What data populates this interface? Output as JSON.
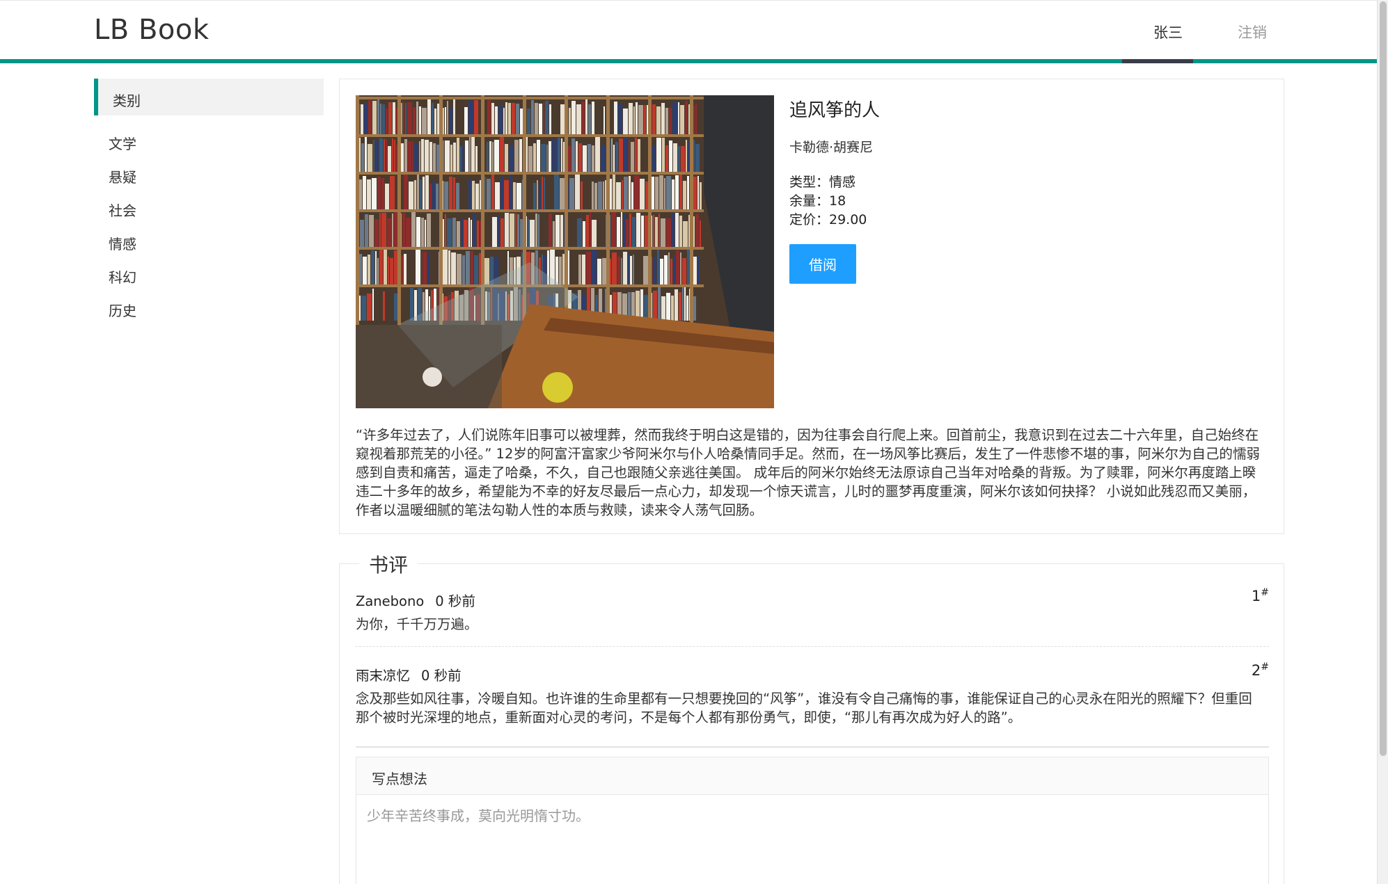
{
  "header": {
    "brand": "LB Book",
    "user": "张三",
    "logout": "注销"
  },
  "sidebar": {
    "heading": "类别",
    "categories": [
      "文学",
      "悬疑",
      "社会",
      "情感",
      "科幻",
      "历史"
    ]
  },
  "book": {
    "title": "追风筝的人",
    "author": "卡勒德·胡赛尼",
    "type_label": "类型：情感",
    "stock_label": "余量：18",
    "price_label": "定价：29.00",
    "borrow_label": "借阅",
    "description": "“许多年过去了，人们说陈年旧事可以被埋葬，然而我终于明白这是错的，因为往事会自行爬上来。回首前尘，我意识到在过去二十六年里，自己始终在窥视着那荒芜的小径。” 12岁的阿富汗富家少爷阿米尔与仆人哈桑情同手足。然而，在一场风筝比赛后，发生了一件悲惨不堪的事，阿米尔为自己的懦弱感到自责和痛苦，逼走了哈桑，不久，自己也跟随父亲逃往美国。 成年后的阿米尔始终无法原谅自己当年对哈桑的背叛。为了赎罪，阿米尔再度踏上暌违二十多年的故乡，希望能为不幸的好友尽最后一点心力，却发现一个惊天谎言，儿时的噩梦再度重演，阿米尔该如何抉择？ 小说如此残忍而又美丽，作者以温暖细腻的笔法勾勒人性的本质与救赎，读来令人荡气回肠。"
  },
  "reviews": {
    "legend": "书评",
    "items": [
      {
        "user": "Zanebono",
        "time": "0 秒前",
        "floor": "1",
        "content": "为你，千千万万遍。"
      },
      {
        "user": "雨末凉忆",
        "time": "0 秒前",
        "floor": "2",
        "content": "念及那些如风往事，冷暖自知。也许谁的生命里都有一只想要挽回的“风筝”，谁没有令自己痛悔的事，谁能保证自己的心灵永在阳光的照耀下？但重回那个被时光深埋的地点，重新面对心灵的考问，不是每个人都有那份勇气，即使，“那儿有再次成为好人的路”。"
      }
    ],
    "floor_mark": "#"
  },
  "comment": {
    "heading": "写点想法",
    "placeholder": "少年辛苦终事成，莫向光明惰寸功。"
  },
  "colors": {
    "accent": "#009688",
    "button": "#1e9fff",
    "active_tab": "#393d49"
  }
}
